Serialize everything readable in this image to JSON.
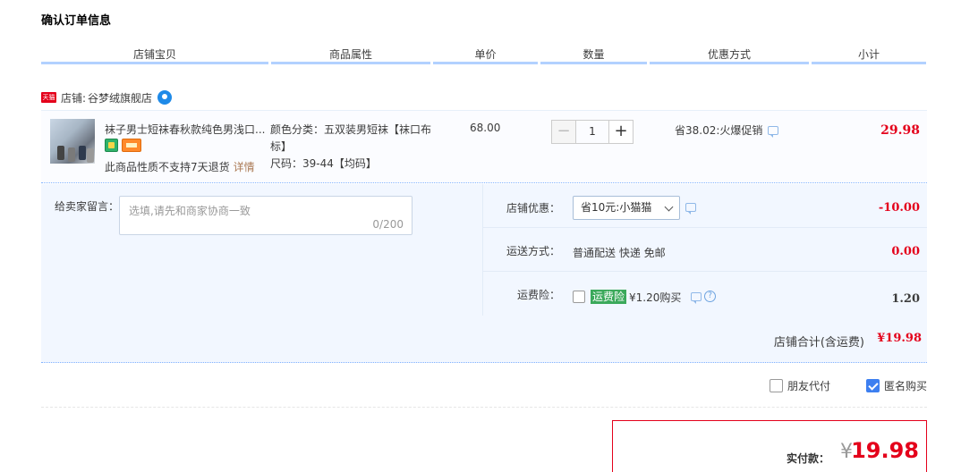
{
  "page": {
    "title": "确认订单信息"
  },
  "columns": [
    "店铺宝贝",
    "商品属性",
    "单价",
    "数量",
    "优惠方式",
    "小计"
  ],
  "shop": {
    "badge": "天猫",
    "label": "店铺:",
    "name": "谷梦绒旗舰店"
  },
  "item": {
    "title": "袜子男士短袜春秋款纯色男浅口...",
    "no_return": "此商品性质不支持7天退货",
    "detail_link": "详情",
    "attr_color": "颜色分类：五双装男短袜【袜口布标】",
    "attr_size": "尺码：39-44【均码】",
    "price": "68.00",
    "quantity": "1",
    "minus": "−",
    "plus": "+",
    "promo": "省38.02:火爆促销",
    "subtotal": "29.98"
  },
  "message": {
    "label": "给卖家留言：",
    "placeholder": "选填,请先和商家协商一致",
    "count": "0/200"
  },
  "shop_discount": {
    "label": "店铺优惠：",
    "selected": "省10元:小猫猫",
    "value": "-10.00"
  },
  "shipping": {
    "label": "运送方式：",
    "method": "普通配送 快递 免邮",
    "value": "0.00"
  },
  "insurance": {
    "label": "运费险：",
    "badge": "运费险",
    "price": "¥1.20购买",
    "help": "?",
    "value": "1.20"
  },
  "shop_total": {
    "label": "店铺合计(含运费)",
    "value": "¥19.98"
  },
  "options": {
    "friend_pay": "朋友代付",
    "anonymous": "匿名购买"
  },
  "payment": {
    "label": "实付款：",
    "currency": "¥",
    "value": "19.98"
  }
}
